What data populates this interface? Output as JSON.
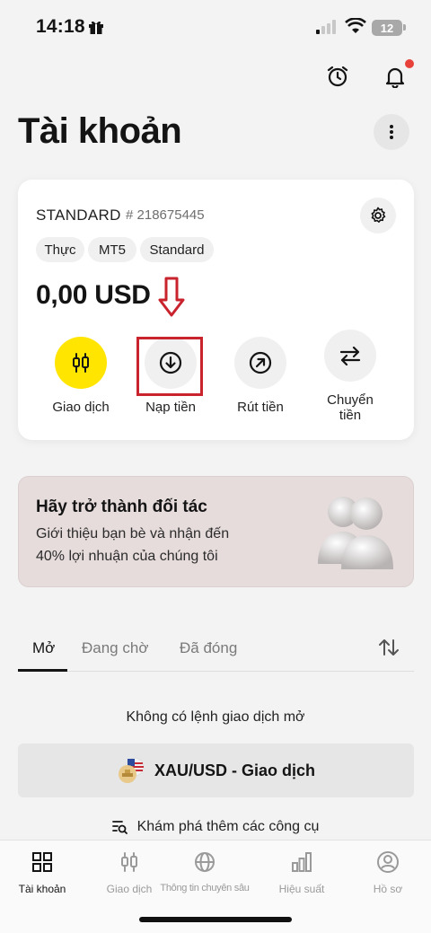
{
  "status_bar": {
    "time": "14:18",
    "battery": "12"
  },
  "header": {
    "title": "Tài khoản"
  },
  "account": {
    "type": "STANDARD",
    "number": "# 218675445",
    "tags": [
      "Thực",
      "MT5",
      "Standard"
    ],
    "balance": "0,00 USD",
    "actions": [
      {
        "label": "Giao dịch",
        "icon": "candlestick-icon"
      },
      {
        "label": "Nạp tiền",
        "icon": "arrow-down-circle-icon"
      },
      {
        "label": "Rút tiền",
        "icon": "arrow-up-right-circle-icon"
      },
      {
        "label": "Chuyển\ntiền",
        "icon": "transfer-arrows-icon"
      }
    ]
  },
  "banner": {
    "title": "Hãy trở thành đối tác",
    "line1": "Giới thiệu bạn bè và nhận đến",
    "line2": "40% lợi nhuận của chúng tôi"
  },
  "orders": {
    "tabs": [
      "Mở",
      "Đang chờ",
      "Đã đóng"
    ],
    "active_tab": "Mở",
    "empty_text": "Không có lệnh giao dịch mở",
    "trade_button": "XAU/USD - Giao dịch",
    "explore_link": "Khám phá thêm các công cụ"
  },
  "bottom_nav": [
    {
      "label": "Tài khoản",
      "icon": "grid-icon",
      "active": true
    },
    {
      "label": "Giao dịch",
      "icon": "candlestick-icon",
      "active": false
    },
    {
      "label": "Thông tin chuyên sâu",
      "icon": "globe-icon",
      "active": false
    },
    {
      "label": "Hiệu suất",
      "icon": "bar-chart-icon",
      "active": false
    },
    {
      "label": "Hồ sơ",
      "icon": "profile-icon",
      "active": false
    }
  ],
  "colors": {
    "accent": "#ffe500",
    "highlight": "#c9232e",
    "notification": "#e8413a"
  }
}
